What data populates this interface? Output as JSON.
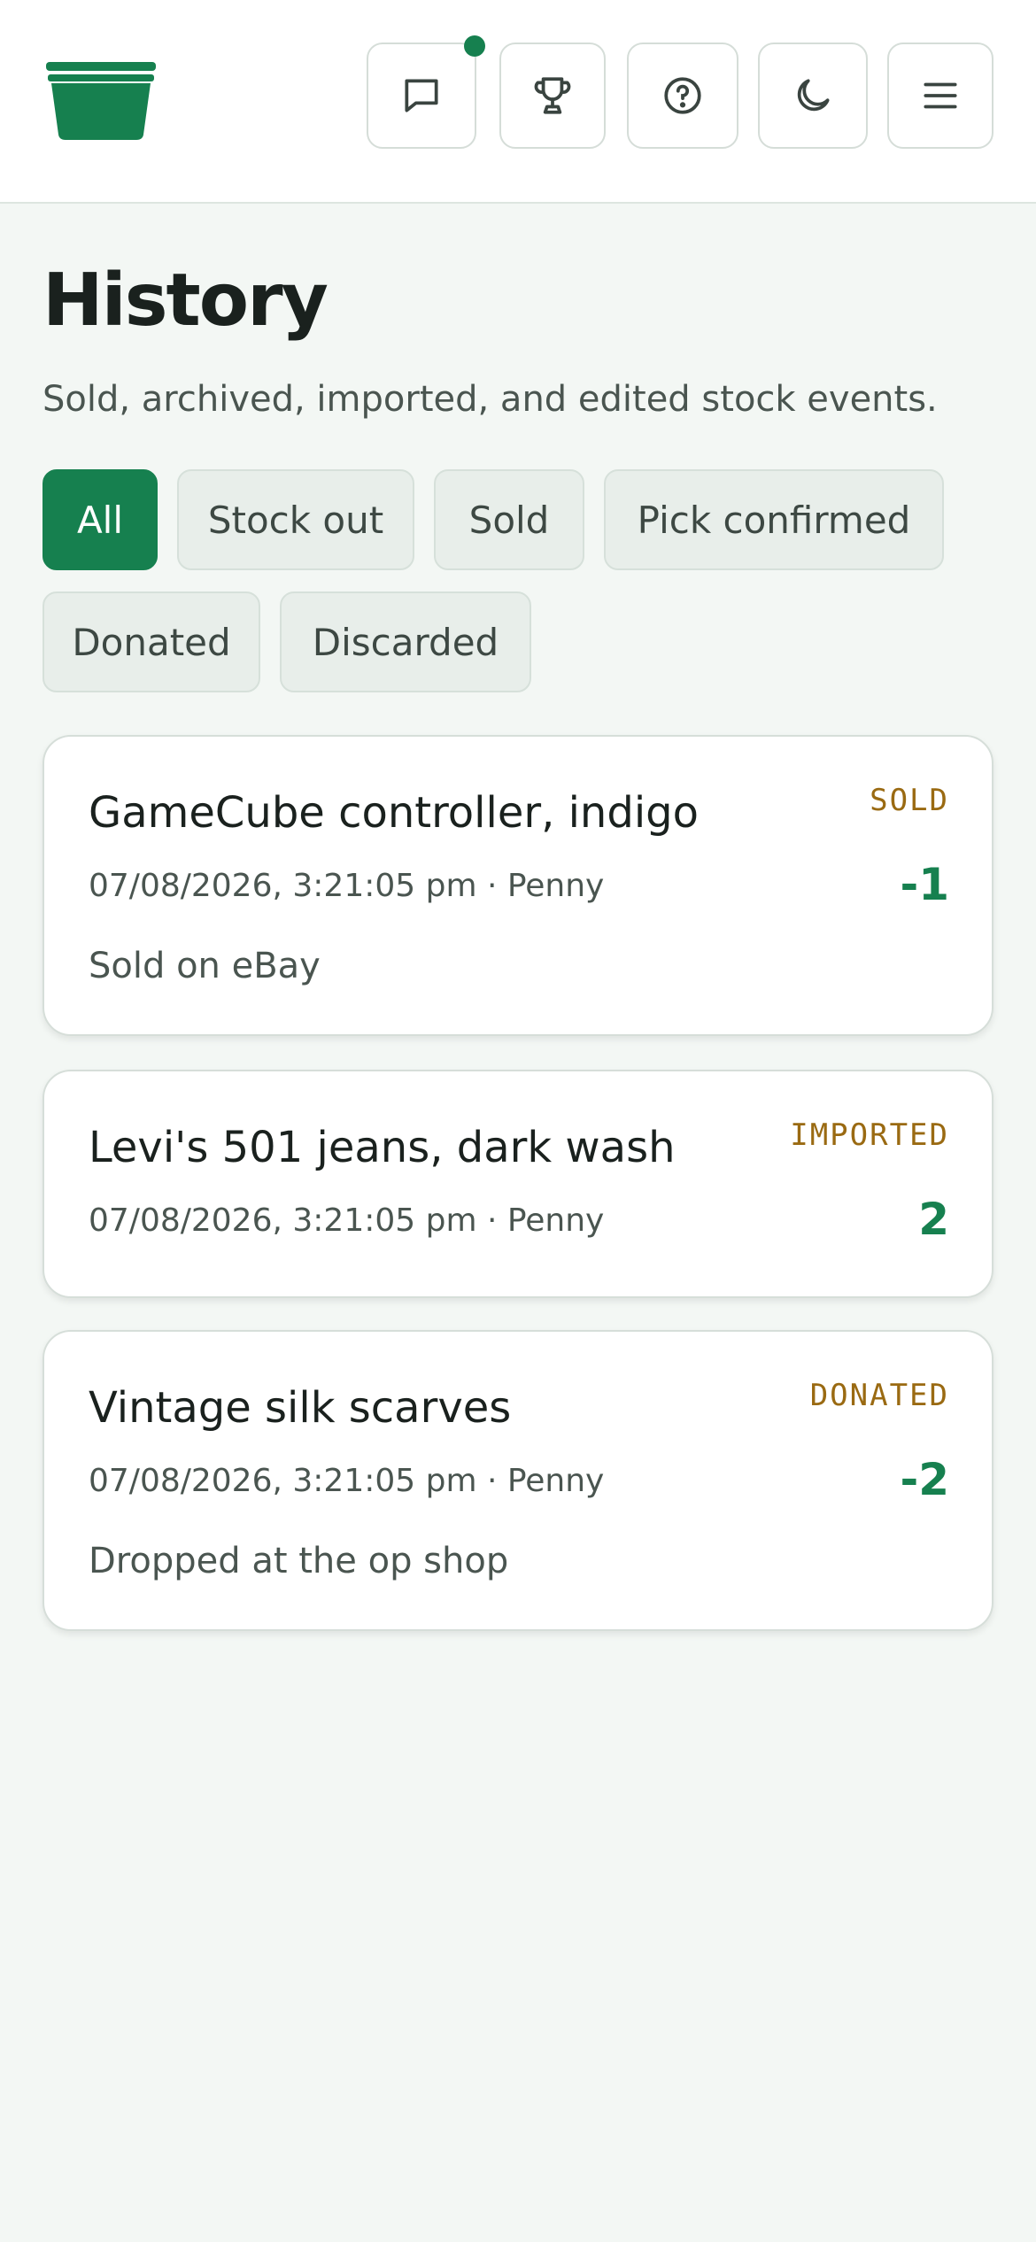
{
  "header": {
    "logo_icon": "storage-bin-icon",
    "buttons": [
      {
        "icon": "message-icon",
        "has_notification": true
      },
      {
        "icon": "trophy-icon"
      },
      {
        "icon": "help-circle-icon"
      },
      {
        "icon": "moon-icon"
      },
      {
        "icon": "menu-icon"
      }
    ]
  },
  "page": {
    "title": "History",
    "subtitle": "Sold, archived, imported, and edited stock events."
  },
  "filters": [
    {
      "label": "All",
      "active": true
    },
    {
      "label": "Stock out",
      "active": false
    },
    {
      "label": "Sold",
      "active": false
    },
    {
      "label": "Pick confirmed",
      "active": false
    },
    {
      "label": "Donated",
      "active": false
    },
    {
      "label": "Discarded",
      "active": false
    }
  ],
  "events": [
    {
      "title": "GameCube controller, indigo",
      "meta": "07/08/2026, 3:21:05 pm · Penny",
      "type": "SOLD",
      "qty": "-1",
      "note": "Sold on eBay"
    },
    {
      "title": "Levi's 501 jeans, dark wash",
      "meta": "07/08/2026, 3:21:05 pm · Penny",
      "type": "IMPORTED",
      "qty": "2",
      "note": ""
    },
    {
      "title": "Vintage silk scarves",
      "meta": "07/08/2026, 3:21:05 pm · Penny",
      "type": "DONATED",
      "qty": "-2",
      "note": "Dropped at the op shop"
    }
  ],
  "colors": {
    "accent": "#16804f",
    "badge": "#9a6a12",
    "background": "#f3f7f4"
  }
}
